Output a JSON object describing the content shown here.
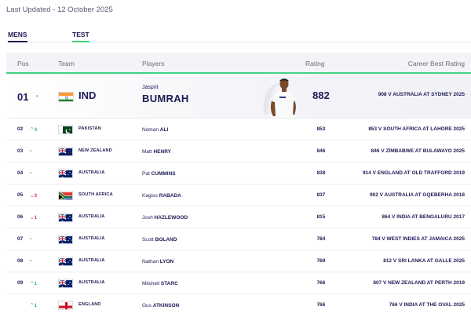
{
  "last_updated": "Last Updated - 12 October 2025",
  "tabs": [
    {
      "label": "MENS",
      "active": true
    },
    {
      "label": "TEST",
      "active": true
    }
  ],
  "columns": {
    "pos": "Pos",
    "team": "Team",
    "players": "Players",
    "rating": "Rating",
    "career_best": "Career Best Rating"
  },
  "colors": {
    "accent_green": "#3fd37f",
    "navy": "#1b1b56",
    "up": "#2bbf6a",
    "down": "#e23b4a"
  },
  "featured": {
    "pos": "01",
    "move": "•",
    "flag": "india",
    "team": "IND",
    "first_name": "Jasprit",
    "last_name": "BUMRAH",
    "rating": "882",
    "career_best": "908 V AUSTRALIA AT SYDNEY 2025"
  },
  "rows": [
    {
      "pos": "02",
      "move": "⌃4",
      "move_dir": "up",
      "flag": "pakistan",
      "team": "PAKISTAN",
      "first": "Noman",
      "last": "ALI",
      "rating": "853",
      "best": "853 V SOUTH AFRICA AT LAHORE 2025"
    },
    {
      "pos": "03",
      "move": "•",
      "move_dir": "same",
      "flag": "newzealand",
      "team": "NEW ZEALAND",
      "first": "Matt",
      "last": "HENRY",
      "rating": "846",
      "best": "846 V ZIMBABWE AT BULAWAYO 2025"
    },
    {
      "pos": "04",
      "move": "•",
      "move_dir": "same",
      "flag": "australia",
      "team": "AUSTRALIA",
      "first": "Pat",
      "last": "CUMMINS",
      "rating": "838",
      "best": "914 V ENGLAND AT OLD TRAFFORD 2019"
    },
    {
      "pos": "05",
      "move": "⌄3",
      "move_dir": "down",
      "flag": "southafrica",
      "team": "SOUTH AFRICA",
      "first": "Kagiso",
      "last": "RABADA",
      "rating": "837",
      "best": "902 V AUSTRALIA AT GQEBERHA 2018"
    },
    {
      "pos": "06",
      "move": "⌄1",
      "move_dir": "down",
      "flag": "australia",
      "team": "AUSTRALIA",
      "first": "Josh",
      "last": "HAZLEWOOD",
      "rating": "815",
      "best": "864 V INDIA AT BENGALURU 2017"
    },
    {
      "pos": "07",
      "move": "•",
      "move_dir": "same",
      "flag": "australia",
      "team": "AUSTRALIA",
      "first": "Scott",
      "last": "BOLAND",
      "rating": "784",
      "best": "784 V WEST INDIES AT JAMAICA 2025"
    },
    {
      "pos": "08",
      "move": "•",
      "move_dir": "same",
      "flag": "australia",
      "team": "AUSTRALIA",
      "first": "Nathan",
      "last": "LYON",
      "rating": "769",
      "best": "812 V SRI LANKA AT GALLE 2025"
    },
    {
      "pos": "09",
      "move": "⌃1",
      "move_dir": "up",
      "flag": "australia",
      "team": "AUSTRALIA",
      "first": "Mitchell",
      "last": "STARC",
      "rating": "766",
      "best": "807 V NEW ZEALAND AT PERTH 2019"
    },
    {
      "pos": "",
      "move": "⌃1",
      "move_dir": "up",
      "flag": "england",
      "team": "ENGLAND",
      "first": "Gus",
      "last": "ATKINSON",
      "rating": "766",
      "best": "766 V INDIA AT THE OVAL 2025"
    }
  ]
}
